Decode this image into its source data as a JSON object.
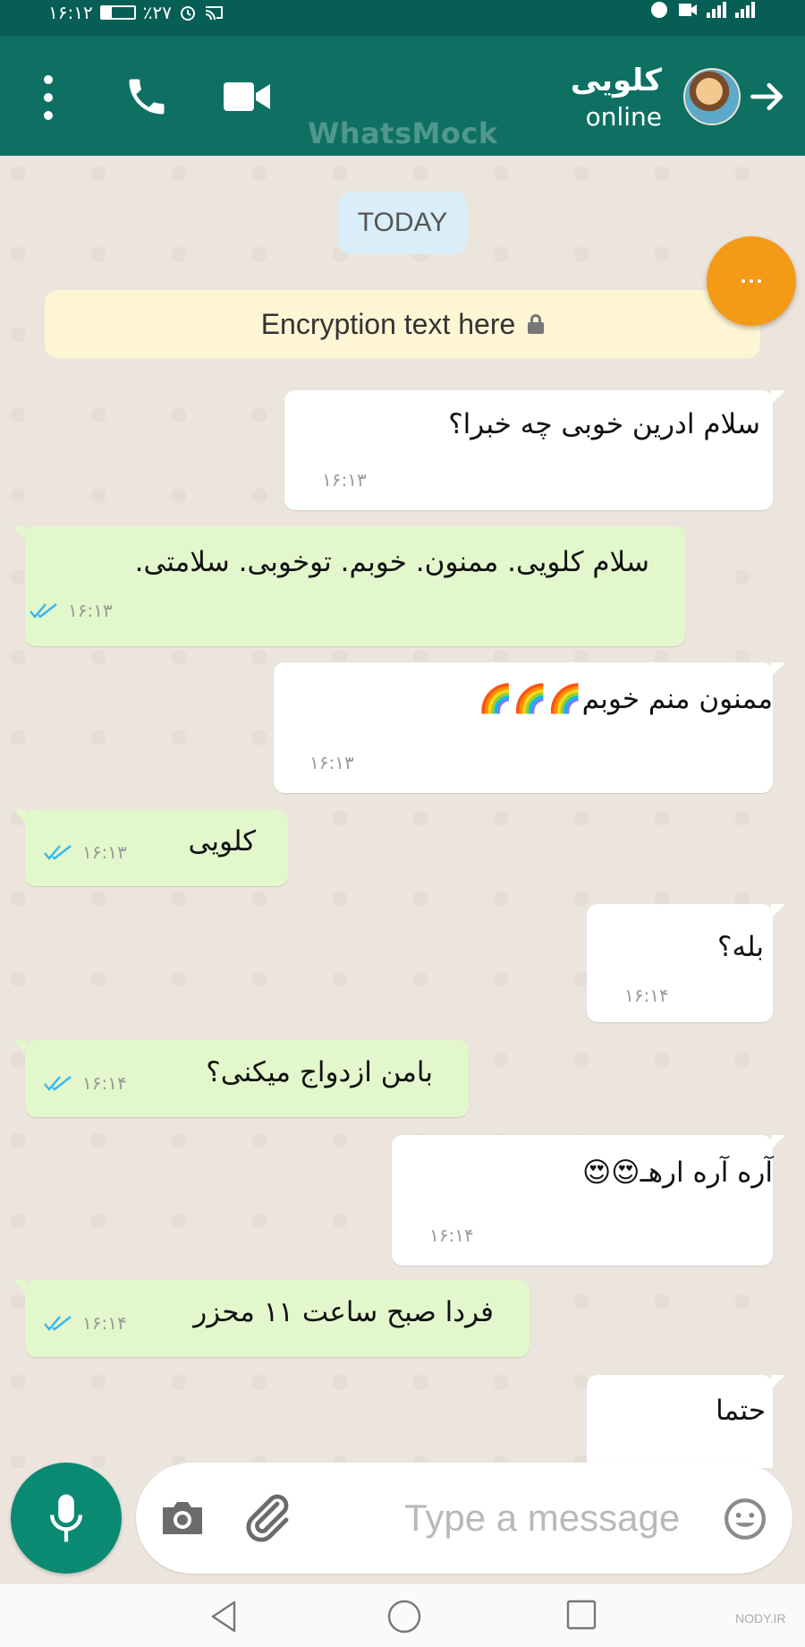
{
  "status_bar": {
    "time": "۱۶:۱۲",
    "battery": "٪۲۷"
  },
  "header": {
    "contact_name": "کلویی",
    "contact_status": "online",
    "watermark": "WhatsMock",
    "icons": [
      "more-vert-icon",
      "phone-icon",
      "video-call-icon",
      "avatar",
      "arrow-forward-icon"
    ]
  },
  "chat": {
    "date_chip": "TODAY",
    "encryption_text": "Encryption text here",
    "messages": [
      {
        "side": "in",
        "text": "سلام ادرین خوبی چه خبرا؟",
        "time": "۱۶:۱۳"
      },
      {
        "side": "out",
        "text": "سلام کلویی. ممنون. خوبم. توخوبی. سلامتی.",
        "time": "۱۶:۱۳",
        "read": true
      },
      {
        "side": "in",
        "text": "ممنون منم خوبم🌈🌈🌈",
        "time": "۱۶:۱۳"
      },
      {
        "side": "out",
        "text": "کلویی",
        "time": "۱۶:۱۳",
        "read": true
      },
      {
        "side": "in",
        "text": "بله؟",
        "time": "۱۶:۱۴"
      },
      {
        "side": "out",
        "text": "بامن ازدواج میکنی؟",
        "time": "۱۶:۱۴",
        "read": true
      },
      {
        "side": "in",
        "text": "آره آره ارهـ😍😍",
        "time": "۱۶:۱۴"
      },
      {
        "side": "out",
        "text": "فردا صبح ساعت ۱۱ محزر",
        "time": "۱۶:۱۴",
        "read": true
      },
      {
        "side": "in",
        "text": "حتما",
        "time": ""
      }
    ]
  },
  "composer": {
    "placeholder": "Type a message"
  },
  "colors": {
    "header": "#0d7063",
    "status_bar": "#075e54",
    "outgoing_bubble": "#e3f7cc",
    "incoming_bubble": "#ffffff",
    "mic_button": "#0b8a73",
    "fab": "#f39a16",
    "read_ticks": "#34b7f1"
  },
  "nav": {
    "watermark": "NODY.IR"
  }
}
